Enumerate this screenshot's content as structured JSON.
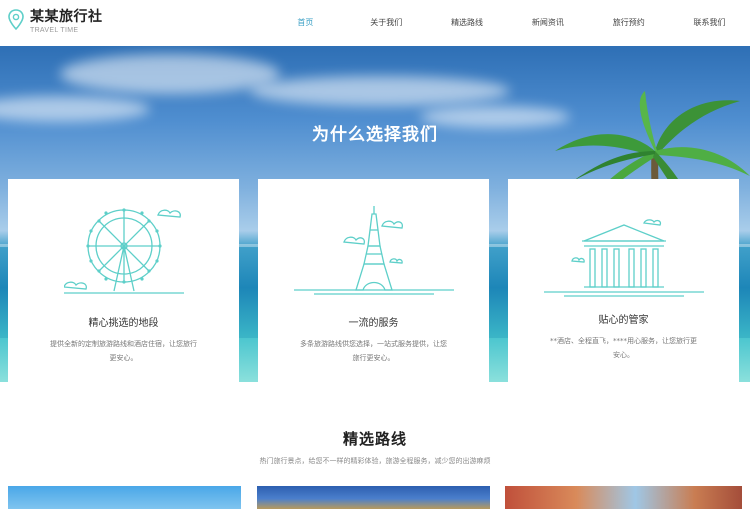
{
  "header": {
    "logo_name": "某某旅行社",
    "logo_sub": "TRAVEL TIME",
    "logo_icon": "location-pin-icon",
    "nav": [
      {
        "label": "首页",
        "active": true
      },
      {
        "label": "关于我们"
      },
      {
        "label": "精选路线"
      },
      {
        "label": "新闻资讯"
      },
      {
        "label": "旅行预约"
      },
      {
        "label": "联系我们"
      }
    ]
  },
  "hero": {
    "title": "为什么选择我们",
    "cards": [
      {
        "icon": "ferris-wheel-icon",
        "title": "精心挑选的地段",
        "desc": "提供全新的定制旅游路线和酒店住宿，让您旅行更安心。"
      },
      {
        "icon": "eiffel-tower-icon",
        "title": "一流的服务",
        "desc": "多条旅游路线供您选择，一站式服务提供，让您旅行更安心。"
      },
      {
        "icon": "pantheon-icon",
        "title": "贴心的管家",
        "desc": "**酒店、全程直飞，****用心服务，让您旅行更安心。"
      }
    ]
  },
  "routes": {
    "title": "精选路线",
    "subtitle": "热门旅行景点，给您不一样的精彩体验，旅游全程服务，减少您的出游麻烦"
  },
  "colors": {
    "accent": "#3a9fc4",
    "icon_line": "#5ecfc9"
  }
}
